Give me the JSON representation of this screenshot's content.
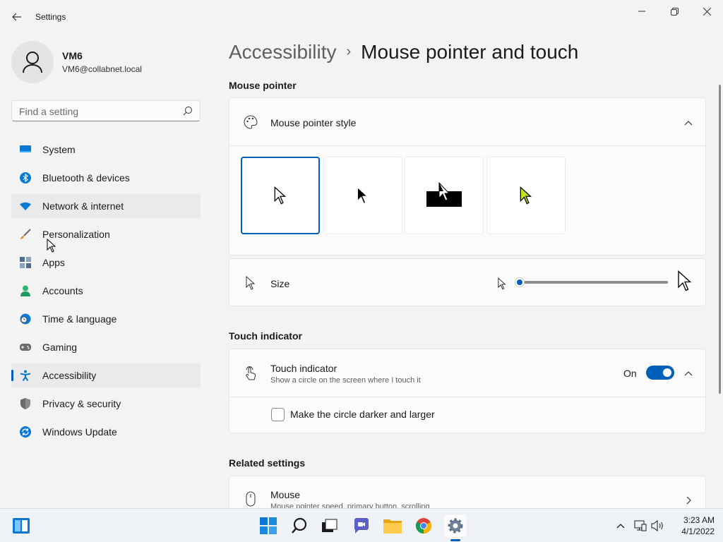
{
  "window": {
    "app_title": "Settings",
    "back_icon": "back-arrow-icon",
    "minimize_icon": "minimize-icon",
    "maximize_icon": "restore-icon",
    "close_icon": "close-icon"
  },
  "profile": {
    "name": "VM6",
    "email": "VM6@collabnet.local"
  },
  "search": {
    "placeholder": "Find a setting"
  },
  "sidebar": {
    "items": [
      {
        "label": "System",
        "icon": "system-icon",
        "color": "#0a78d4"
      },
      {
        "label": "Bluetooth & devices",
        "icon": "bluetooth-icon",
        "color": "#0a78d4"
      },
      {
        "label": "Network & internet",
        "icon": "wifi-icon",
        "color": "#0a78d4"
      },
      {
        "label": "Personalization",
        "icon": "brush-icon",
        "color": "#e38a2d"
      },
      {
        "label": "Apps",
        "icon": "apps-icon",
        "color": "#4f6d8a"
      },
      {
        "label": "Accounts",
        "icon": "accounts-icon",
        "color": "#2bb673"
      },
      {
        "label": "Time & language",
        "icon": "clock-globe-icon",
        "color": "#0a78d4"
      },
      {
        "label": "Gaming",
        "icon": "gamepad-icon",
        "color": "#6b6b6b"
      },
      {
        "label": "Accessibility",
        "icon": "accessibility-icon",
        "color": "#0a78d4"
      },
      {
        "label": "Privacy & security",
        "icon": "shield-icon",
        "color": "#6b6b6b"
      },
      {
        "label": "Windows Update",
        "icon": "update-icon",
        "color": "#0a78d4"
      }
    ],
    "active": "Accessibility",
    "hovered": "Network & internet"
  },
  "header": {
    "parent": "Accessibility",
    "separator": "›",
    "current": "Mouse pointer and touch"
  },
  "mouse_pointer": {
    "section_title": "Mouse pointer",
    "style_label": "Mouse pointer style",
    "styles": [
      "white",
      "black",
      "inverted",
      "custom"
    ],
    "selected_style": "white",
    "custom_color": "#c6e21c",
    "size_label": "Size",
    "size_value": 0
  },
  "touch": {
    "section_title": "Touch indicator",
    "label": "Touch indicator",
    "description": "Show a circle on the screen where I touch it",
    "state_text": "On",
    "enabled": true,
    "checkbox_label": "Make the circle darker and larger",
    "checkbox_checked": false
  },
  "related": {
    "section_title": "Related settings",
    "mouse_label": "Mouse",
    "mouse_description": "Mouse pointer speed, primary button, scrolling"
  },
  "taskbar": {
    "time": "3:23 AM",
    "date": "4/1/2022",
    "apps": [
      "start-icon",
      "search-icon",
      "task-view-icon",
      "teams-chat-icon",
      "file-explorer-icon",
      "chrome-icon",
      "settings-icon"
    ],
    "accent": "#005fb8"
  }
}
